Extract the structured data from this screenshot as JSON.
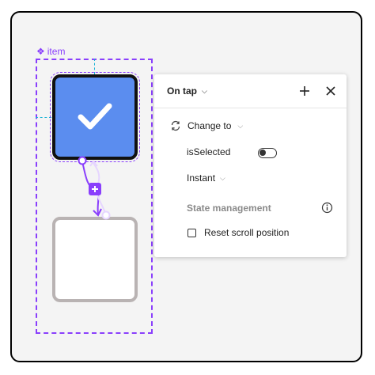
{
  "canvas": {
    "component_label": "item"
  },
  "panel": {
    "trigger": "On tap",
    "action": "Change to",
    "property": "isSelected",
    "property_value": false,
    "transition": "Instant",
    "section_title": "State management",
    "reset_label": "Reset scroll position",
    "reset_checked": false
  },
  "colors": {
    "accent": "#8a3ffc",
    "selected_fill": "#5b8def",
    "guide": "#19b3d6"
  },
  "icons": [
    "component-diamond-icon",
    "checkmark-icon",
    "plus-icon",
    "close-icon",
    "refresh-icon",
    "chevron-down-icon",
    "info-icon"
  ]
}
